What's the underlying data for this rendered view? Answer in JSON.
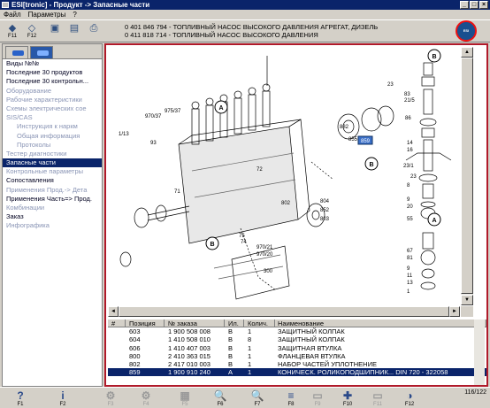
{
  "window": {
    "title": "ESI[tronic] - Продукт -> Запасные части",
    "controls": [
      "_",
      "□",
      "×"
    ]
  },
  "menu": [
    "Файл",
    "Параметры",
    "?"
  ],
  "toolbar": [
    {
      "glyph": "◆",
      "key": "F11"
    },
    {
      "glyph": "◇",
      "key": "F12"
    },
    {
      "glyph": "▣",
      "key": ""
    },
    {
      "glyph": "▤",
      "key": ""
    },
    {
      "glyph": "⎙",
      "key": ""
    }
  ],
  "header": {
    "line1": "0 401 846 794 - ТОПЛИВНЫЙ НАСОС ВЫСОКОГО ДАВЛЕНИЯ АГРЕГАТ, ДИЗЕЛЬ",
    "line2": "0 411 818 714 - ТОПЛИВНЫЙ НАСОС ВЫСОКОГО ДАВЛЕНИЯ",
    "logo_text": "ESI"
  },
  "sidebar": {
    "items": [
      {
        "label": "Виды №№",
        "state": "normal"
      },
      {
        "label": "Последние 30 продуктов",
        "state": "normal"
      },
      {
        "label": "Последние 30 контрольн...",
        "state": "normal"
      },
      {
        "label": "Оборудование",
        "state": "disabled"
      },
      {
        "label": "Рабочие характеристики",
        "state": "disabled"
      },
      {
        "label": "Схемы электрических сое",
        "state": "disabled"
      },
      {
        "label": "SIS/CAS",
        "state": "disabled"
      },
      {
        "label": "Инструкция к наркм",
        "state": "disabled",
        "sub": true
      },
      {
        "label": "Общая информация",
        "state": "disabled",
        "sub": true
      },
      {
        "label": "Протоколы",
        "state": "disabled",
        "sub": true
      },
      {
        "label": "Тестер диагностики",
        "state": "disabled"
      },
      {
        "label": "Запасные части",
        "state": "selected"
      },
      {
        "label": "Контрольные параметры",
        "state": "disabled"
      },
      {
        "label": "Сопоставления",
        "state": "normal"
      },
      {
        "label": "Применения Прод.-> Дета",
        "state": "disabled"
      },
      {
        "label": "Применения Часть=> Прод.",
        "state": "normal"
      },
      {
        "label": "Комбинации",
        "state": "disabled"
      },
      {
        "label": "Заказ",
        "state": "normal"
      },
      {
        "label": "Инфографика",
        "state": "disabled"
      }
    ]
  },
  "drawing": {
    "labels": [
      "970/37",
      "1/13",
      "93",
      "71",
      "A",
      "B",
      "B",
      "A",
      "B",
      "72",
      "975/37",
      "802",
      "804",
      "852",
      "803",
      "859",
      "882",
      "75",
      "74",
      "970/21",
      "970/20",
      "300",
      "23/1",
      "855",
      "23",
      "83",
      "21/5",
      "86",
      "14",
      "16",
      "8",
      "9",
      "20",
      "55",
      "67",
      "81",
      "9",
      "11",
      "13",
      "1",
      "23",
      "80",
      "2",
      "5",
      "6",
      "7",
      "4",
      "3"
    ],
    "tag": "859"
  },
  "table": {
    "columns": [
      "#",
      "Позиция",
      "№ заказа",
      "Ил.",
      "Колич.",
      "Наименование"
    ],
    "rows": [
      {
        "pos": "603",
        "order": "1 900 508 008",
        "il": "B",
        "qty": "1",
        "name": "ЗАЩИТНЫЙ КОЛПАК"
      },
      {
        "pos": "604",
        "order": "1 410 508 010",
        "il": "B",
        "qty": "8",
        "name": "ЗАЩИТНЫЙ КОЛПАК"
      },
      {
        "pos": "606",
        "order": "1 410 407 003",
        "il": "B",
        "qty": "1",
        "name": "ЗАЩИТНАЯ ВТУЛКА"
      },
      {
        "pos": "800",
        "order": "2 410 363 015",
        "il": "B",
        "qty": "1",
        "name": "ФЛАНЦЕВАЯ ВТУЛКА"
      },
      {
        "pos": "802",
        "order": "2 417 010 003",
        "il": "B",
        "qty": "1",
        "name": "НАБОР ЧАСТЕЙ УПЛОТНЕНИЕ"
      },
      {
        "pos": "859",
        "order": "1 900 910 240",
        "il": "A",
        "qty": "1",
        "name": "КОНИЧЕСК. РОЛИКОПОДШИПНИК... DIN 720 - 322058",
        "selected": true
      }
    ]
  },
  "bottombar": [
    {
      "glyph": "?",
      "key": "F1"
    },
    {
      "glyph": "i",
      "key": "F2"
    },
    {
      "glyph": "⚙",
      "key": "F3",
      "disabled": true
    },
    {
      "glyph": "⚙",
      "key": "F4",
      "disabled": true
    },
    {
      "glyph": "▦",
      "key": "F5",
      "disabled": true
    },
    {
      "glyph": "🔍",
      "key": "F6"
    },
    {
      "glyph": "🔍",
      "key": "F7"
    },
    {
      "glyph": "≡",
      "key": "F8"
    },
    {
      "glyph": "▭",
      "key": "F9",
      "disabled": true
    },
    {
      "glyph": "✚",
      "key": "F10"
    },
    {
      "glyph": "▭",
      "key": "F11",
      "disabled": true
    },
    {
      "glyph": "◑",
      "key": "F12"
    }
  ],
  "status": {
    "page": "116/122"
  },
  "colors": {
    "title_bg": "#0a246a",
    "selected_bg": "#0a246a",
    "frame": "#b01a2a",
    "disabled_text": "#8a95b5"
  }
}
